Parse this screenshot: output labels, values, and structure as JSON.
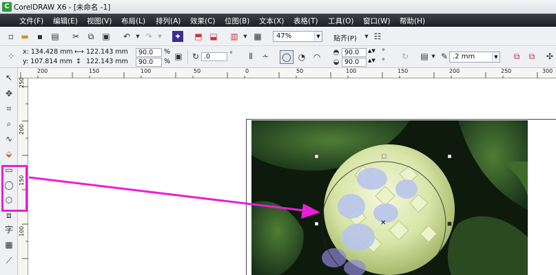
{
  "window": {
    "title": "CorelDRAW X6 - [未命名 -1]",
    "logo": "corel-logo"
  },
  "menu": [
    "文件(F)",
    "编辑(E)",
    "视图(V)",
    "布局(L)",
    "排列(A)",
    "效果(C)",
    "位图(B)",
    "文本(X)",
    "表格(T)",
    "工具(O)",
    "窗口(W)",
    "帮助(H)"
  ],
  "toolbar": {
    "zoom": "47%",
    "snap": "贴齐(P)"
  },
  "property_bar": {
    "x": "x: 134.428 mm",
    "y": "y: 107.814 mm",
    "w": "122.143 mm",
    "h": "122.143 mm",
    "scale_x": "90.0",
    "scale_y": "90.0",
    "percent": "%",
    "rotation": ".0",
    "degree": "°",
    "start_angle": "90.0",
    "end_angle": "90.0",
    "outline": ".2 mm"
  },
  "ruler": {
    "h_ticks": [
      "200",
      "150",
      "100",
      "50",
      "0",
      "50",
      "100",
      "150",
      "200",
      "250",
      "300"
    ],
    "v_ticks": [
      "250",
      "200",
      "150",
      "100"
    ]
  },
  "annotation": {
    "highlight_color": "#e81fd6",
    "arrow_color": "#e81fd6"
  },
  "colors": {
    "menubar": "#2b2e33",
    "page_border": "#444444"
  }
}
